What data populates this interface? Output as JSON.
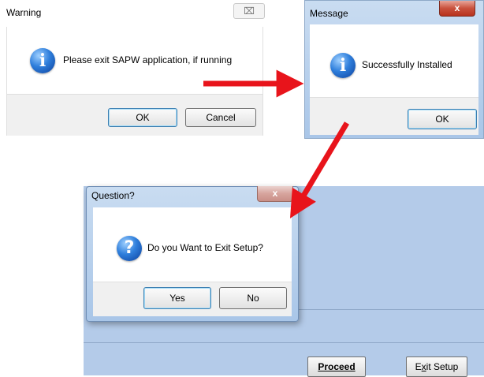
{
  "warning_dialog": {
    "title": "Warning",
    "close_glyph": "⌧",
    "message": "Please exit SAPW application, if running",
    "icon": "info-icon",
    "ok_label": "OK",
    "cancel_label": "Cancel"
  },
  "message_dialog": {
    "title": "Message",
    "close_glyph": "x",
    "message": "Successfully Installed",
    "icon": "info-icon",
    "ok_label": "OK"
  },
  "question_dialog": {
    "title": "Question?",
    "close_glyph": "x",
    "message": "Do you Want to Exit Setup?",
    "icon": "question-icon",
    "yes_label": "Yes",
    "no_label": "No"
  },
  "setup_window": {
    "proceed_label": "Proceed",
    "exit_setup_prefix": "E",
    "exit_setup_accel": "x",
    "exit_setup_suffix": "it Setup"
  },
  "colors": {
    "arrow": "#e8141b",
    "setup_background": "#b4cbe9",
    "dialog_frame": "#b9d1ee"
  }
}
